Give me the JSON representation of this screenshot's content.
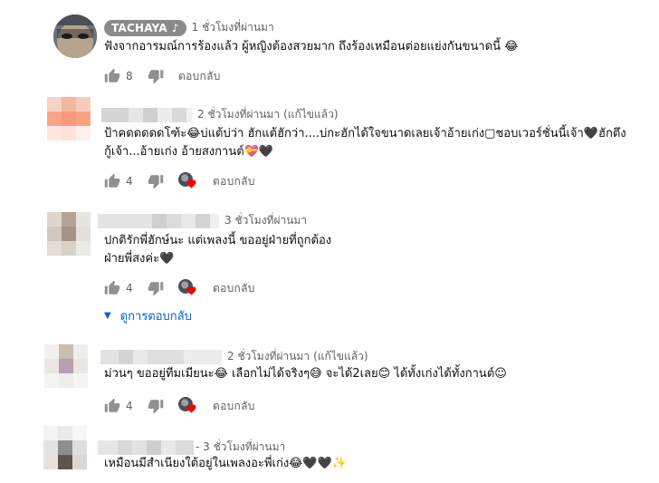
{
  "colors": {
    "link": "#065fd4",
    "secondary_text": "#606060",
    "heart": "#ff0000",
    "badge_bg": "#8a8a8a"
  },
  "comments": [
    {
      "author": "TACHAYA",
      "author_icon": "music-note-icon",
      "time": "1 ชั่วโมงที่ผ่านมา",
      "edited": "",
      "text_lines": [
        "ฟังจากอารมณ์การร้องแล้ว ผู้หญิงต้องสวยมาก ถึงร้องเหมือนต่อยแย่งกันขนาดนี้ 😂"
      ],
      "likes": "8",
      "reply_label": "ตอบกลับ",
      "hearted_by_creator": false
    },
    {
      "author": "",
      "time": "2 ชั่วโมงที่ผ่านมา",
      "edited": "(แก้ไขแล้ว)",
      "text_lines": [
        "ป้าคดดดดดโฑ้ะ😂บ่แต้บ่ว่า ฮักแต้ฮักว่า....บ่กะฮักได้ใจขนาดเลยเจ้าอ้ายเก่ง▢ชอบเวอร์ชั่นนี้เจ้า🖤ฮักตึง",
        "กู้เจ้า...อ้ายเก่ง อ้ายสงกานต์💝🖤"
      ],
      "likes": "4",
      "reply_label": "ตอบกลับ",
      "hearted_by_creator": true
    },
    {
      "author": "",
      "time": "3 ชั่วโมงที่ผ่านมา",
      "edited": "",
      "text_lines": [
        "ปกติรักพี่ฮักษ์นะ แต่เพลงนี้ ขออยู่ฝ่ายที่ถูกต้อง",
        "ฝ่ายพี่สงค่ะ🖤"
      ],
      "likes": "4",
      "reply_label": "ตอบกลับ",
      "hearted_by_creator": true,
      "view_replies_label": "ดูการตอบกลับ"
    },
    {
      "author": "",
      "time": "2 ชั่วโมงที่ผ่านมา",
      "edited": "(แก้ไขแล้ว)",
      "text_lines": [
        "ม่วนๆ ขออยู่ทีมเมียนะ😂 เลือกไม่ได้จริงๆ😅 จะได้2เลย😊 ได้ทั้งเก่งได้ทั้งกานต์☺"
      ],
      "likes": "4",
      "reply_label": "ตอบกลับ",
      "hearted_by_creator": true
    },
    {
      "author": "",
      "time": "- 3 ชั่วโมงที่ผ่านมา",
      "edited": "",
      "text_lines": [
        "เหมือนมีสำเนียงใต้อยู่ในเพลงอะพี่เก่ง😂🖤🖤✨"
      ],
      "likes": "",
      "reply_label": "",
      "hearted_by_creator": false
    }
  ]
}
